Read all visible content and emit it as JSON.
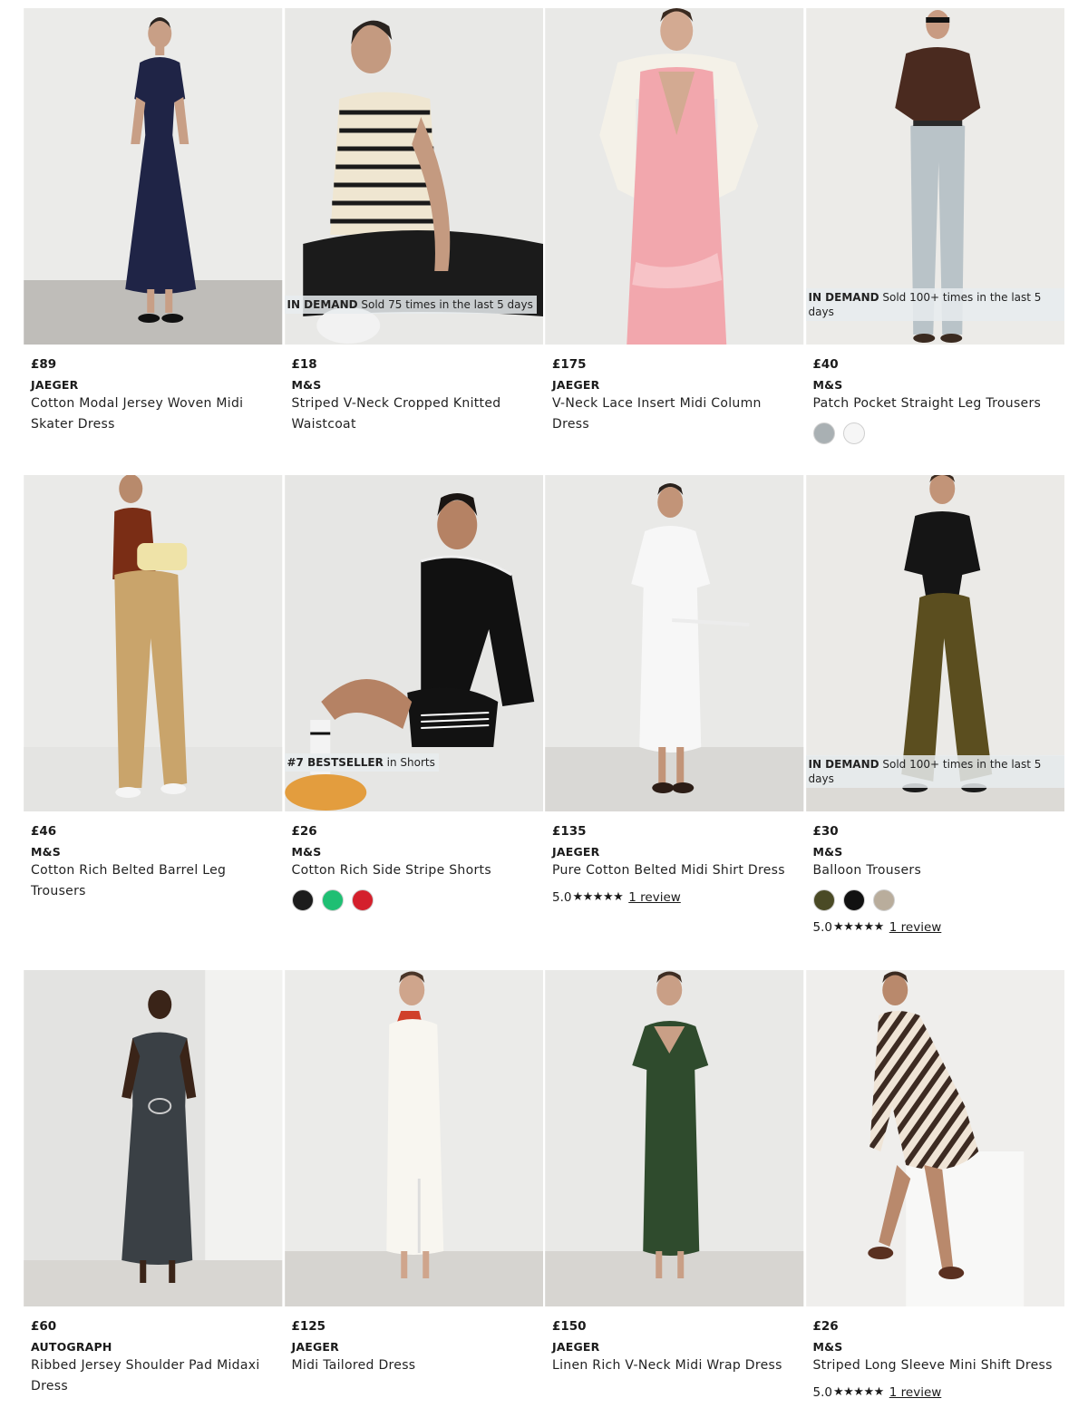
{
  "products": [
    {
      "price": "£89",
      "brand": "JAEGER",
      "title": "Cotton Modal Jersey Woven Midi Skater Dress",
      "badge": null
    },
    {
      "price": "£18",
      "brand": "M&S",
      "title": "Striped V-Neck Cropped Knitted Waistcoat",
      "badge": {
        "strong": "IN DEMAND",
        "text": " Sold 75 times in the last 5 days"
      }
    },
    {
      "price": "£175",
      "brand": "JAEGER",
      "title": "V-Neck Lace Insert Midi Column Dress",
      "badge": null
    },
    {
      "price": "£40",
      "brand": "M&S",
      "title": "Patch Pocket Straight Leg Trousers",
      "badge": {
        "strong": "IN DEMAND",
        "text": " Sold 100+ times in the last 5 days"
      },
      "swatches": [
        "#a9b0b3",
        "#f6f6f6"
      ]
    },
    {
      "price": "£46",
      "brand": "M&S",
      "title": "Cotton Rich Belted Barrel Leg Trousers",
      "badge": null
    },
    {
      "price": "£26",
      "brand": "M&S",
      "title": "Cotton Rich Side Stripe Shorts",
      "badge": {
        "strong": "#7 BESTSELLER",
        "text": " in Shorts"
      },
      "swatches": [
        "#1c1c1c",
        "#1fbf73",
        "#d4202c"
      ]
    },
    {
      "price": "£135",
      "brand": "JAEGER",
      "title": "Pure Cotton Belted Midi Shirt Dress",
      "badge": null,
      "rating": {
        "score": "5.0",
        "stars": "★★★★★",
        "reviews": "1 review"
      }
    },
    {
      "price": "£30",
      "brand": "M&S",
      "title": "Balloon Trousers",
      "badge": {
        "strong": "IN DEMAND",
        "text": " Sold 100+ times in the last 5 days"
      },
      "swatches": [
        "#4a4a25",
        "#111111",
        "#b9ad9c"
      ],
      "rating": {
        "score": "5.0",
        "stars": "★★★★★",
        "reviews": "1 review"
      }
    },
    {
      "price": "£60",
      "brand": "AUTOGRAPH",
      "title": "Ribbed Jersey Shoulder Pad Midaxi Dress",
      "badge": null
    },
    {
      "price": "£125",
      "brand": "JAEGER",
      "title": "Midi Tailored Dress",
      "badge": null
    },
    {
      "price": "£150",
      "brand": "JAEGER",
      "title": "Linen Rich V-Neck Midi Wrap Dress",
      "badge": null
    },
    {
      "price": "£26",
      "brand": "M&S",
      "title": "Striped Long Sleeve Mini Shift Dress",
      "badge": null,
      "rating": {
        "score": "5.0",
        "stars": "★★★★★",
        "reviews": "1 review"
      }
    }
  ]
}
